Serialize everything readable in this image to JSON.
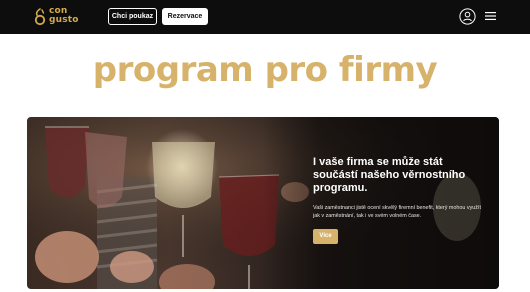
{
  "header": {
    "logo_line1": "con",
    "logo_line2": "gusto",
    "voucher_label": "Chci poukaz",
    "reserve_label": "Rezervace",
    "user_icon": "user-icon",
    "menu_icon": "hamburger-menu-icon"
  },
  "main": {
    "title": "program pro firmy"
  },
  "hero": {
    "heading": "I vaše firma se může stát součástí našeho věrnostního programu.",
    "text": "Vaši zaměstnanci jistě ocení skvělý firemní benefit, který mohou využít jak v zaměstnání, tak i ve svém volném čase.",
    "button_label": "Více"
  },
  "colors": {
    "header_bg": "#0d0d0d",
    "accent_gold": "#d7b26a",
    "logo_gold": "#d4a94c"
  }
}
